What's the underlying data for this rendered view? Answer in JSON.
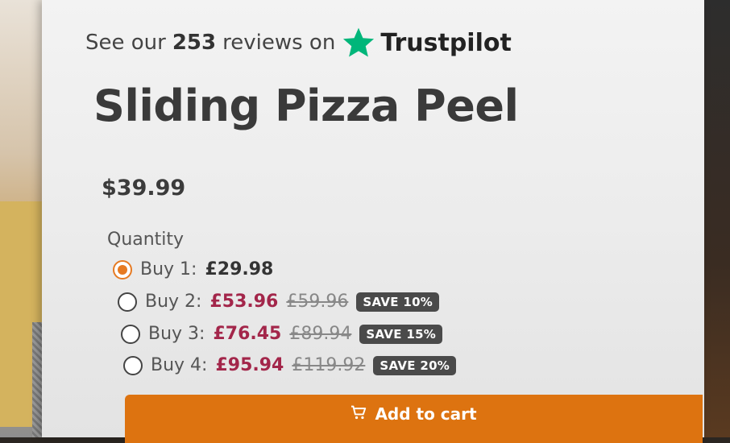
{
  "trustpilot": {
    "prefix": "See our",
    "count": "253",
    "suffix": "reviews on",
    "brand": "Trustpilot",
    "star_color": "#00b67a"
  },
  "product": {
    "title": "Sliding Pizza Peel",
    "price": "$39.99"
  },
  "quantity": {
    "label": "Quantity",
    "options": [
      {
        "label": "Buy 1:",
        "price": "£29.98",
        "old_price": "",
        "badge": "",
        "selected": true
      },
      {
        "label": "Buy 2:",
        "price": "£53.96",
        "old_price": "£59.96",
        "badge": "SAVE 10%",
        "selected": false
      },
      {
        "label": "Buy 3:",
        "price": "£76.45",
        "old_price": "£89.94",
        "badge": "SAVE 15%",
        "selected": false
      },
      {
        "label": "Buy 4:",
        "price": "£95.94",
        "old_price": "£119.92",
        "badge": "SAVE 20%",
        "selected": false
      }
    ]
  },
  "cart": {
    "label": "Add to cart",
    "icon": "cart-icon",
    "color": "#dd7310"
  },
  "colors": {
    "accent": "#e67a22",
    "sale_price": "#a3264a",
    "badge_bg": "#4a4a4a"
  }
}
